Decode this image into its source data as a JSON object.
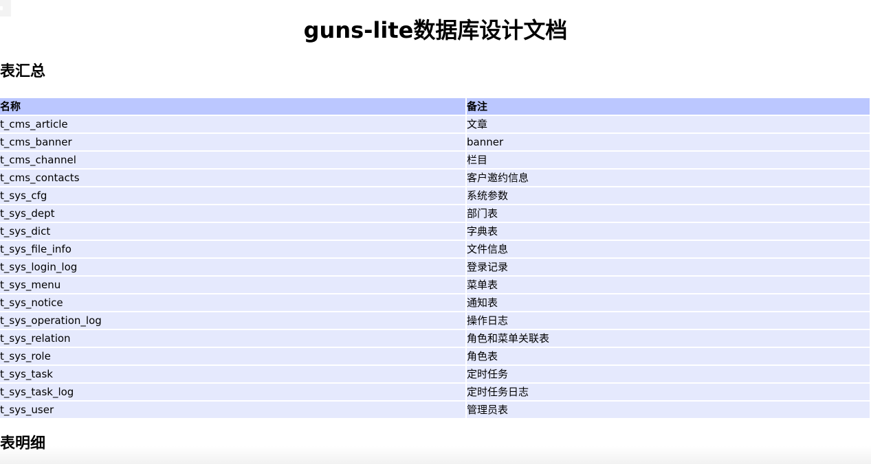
{
  "document": {
    "title": "guns-lite数据库设计文档",
    "summary_heading": "表汇总",
    "detail_heading": "表明细"
  },
  "summary_table": {
    "headers": [
      "名称",
      "备注"
    ],
    "rows": [
      [
        "t_cms_article",
        "文章"
      ],
      [
        "t_cms_banner",
        "banner"
      ],
      [
        "t_cms_channel",
        "栏目"
      ],
      [
        "t_cms_contacts",
        "客户邀约信息"
      ],
      [
        "t_sys_cfg",
        "系统参数"
      ],
      [
        "t_sys_dept",
        "部门表"
      ],
      [
        "t_sys_dict",
        "字典表"
      ],
      [
        "t_sys_file_info",
        "文件信息"
      ],
      [
        "t_sys_login_log",
        "登录记录"
      ],
      [
        "t_sys_menu",
        "菜单表"
      ],
      [
        "t_sys_notice",
        "通知表"
      ],
      [
        "t_sys_operation_log",
        "操作日志"
      ],
      [
        "t_sys_relation",
        "角色和菜单关联表"
      ],
      [
        "t_sys_role",
        "角色表"
      ],
      [
        "t_sys_task",
        "定时任务"
      ],
      [
        "t_sys_task_log",
        "定时任务日志"
      ],
      [
        "t_sys_user",
        "管理员表"
      ]
    ]
  },
  "colors": {
    "header_bg": "#bbc7ff",
    "row_bg": "#e5e9fd"
  }
}
